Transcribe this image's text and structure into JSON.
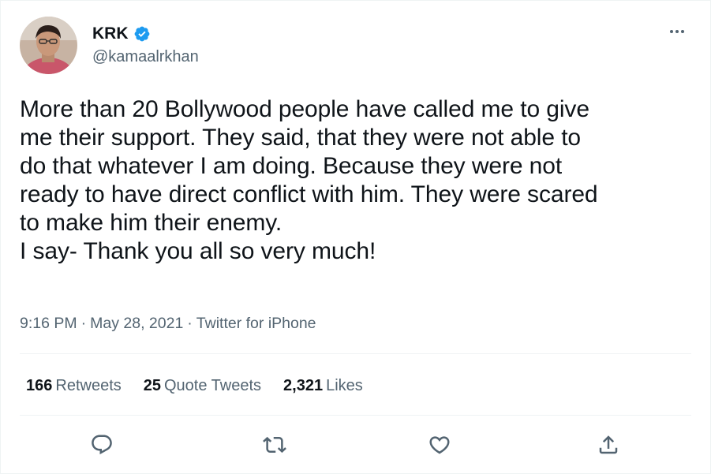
{
  "author": {
    "display_name": "KRK",
    "handle": "@kamaalrkhan",
    "verified": true,
    "avatar_icon": "profile-photo"
  },
  "tweet": {
    "text": "More than 20 Bollywood people have called me to give\nme their support. They said, that they were not able to\ndo that whatever I am doing. Because they were not\nready to have direct conflict with him. They were scared\nto make him their enemy.\nI say- Thank you all so very much!"
  },
  "meta": {
    "time": "9:16 PM",
    "separator": "·",
    "date": "May 28, 2021",
    "source": "Twitter for iPhone"
  },
  "stats": {
    "retweets": {
      "count": "166",
      "label": "Retweets"
    },
    "quote_tweets": {
      "count": "25",
      "label": "Quote Tweets"
    },
    "likes": {
      "count": "2,321",
      "label": "Likes"
    }
  },
  "actions": [
    "reply-icon",
    "retweet-icon",
    "like-icon",
    "share-icon"
  ],
  "colors": {
    "text": "#0f1419",
    "secondary": "#536471",
    "verified": "#1d9bf0",
    "divider": "#eff3f4"
  }
}
